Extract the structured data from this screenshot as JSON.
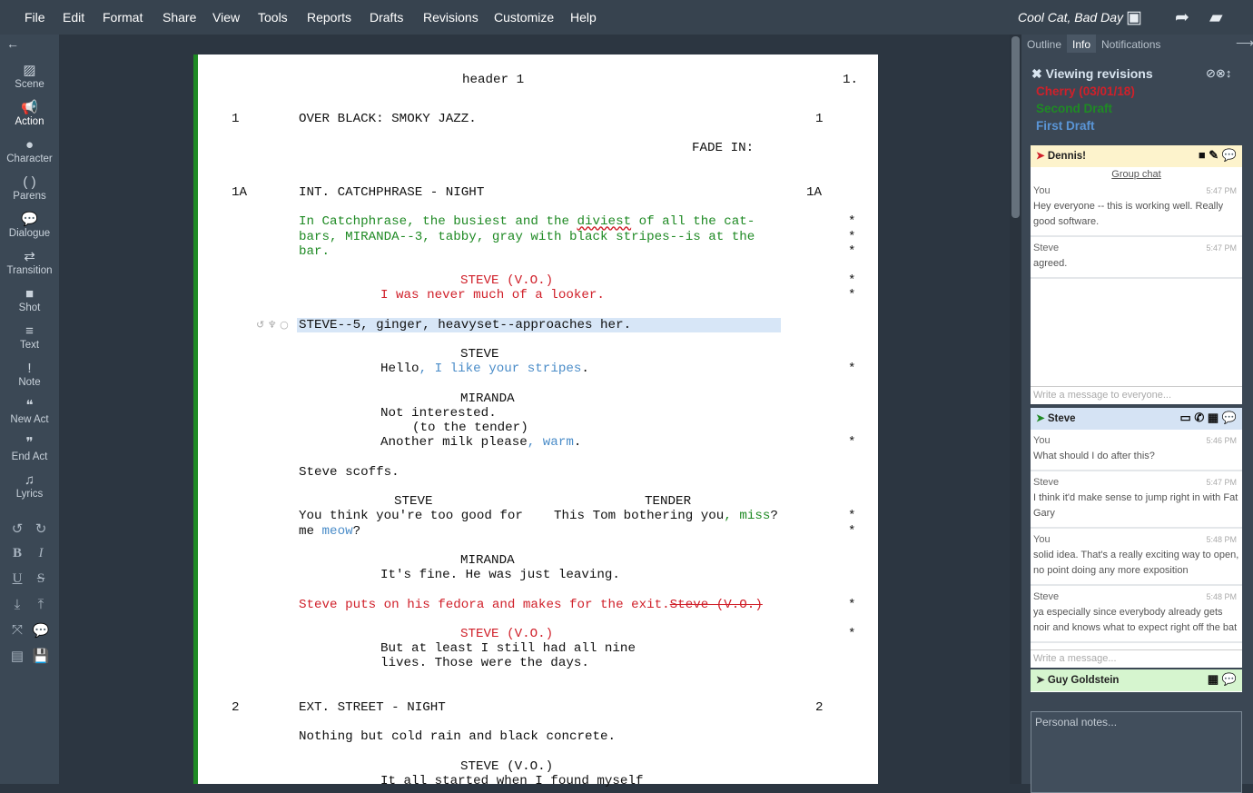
{
  "menu": [
    "File",
    "Edit",
    "Format",
    "Share",
    "View",
    "Tools",
    "Reports",
    "Drafts",
    "Revisions",
    "Customize",
    "Help"
  ],
  "document_title": "Cool Cat, Bad Day",
  "toolbar_icons": [
    "save-icon",
    "share-forward-icon",
    "open-folder-icon"
  ],
  "elements": [
    {
      "label": "Scene",
      "icon": "image-icon",
      "glyph": "▨"
    },
    {
      "label": "Action",
      "icon": "megaphone-icon",
      "glyph": "📢",
      "active": true
    },
    {
      "label": "Character",
      "icon": "person-icon",
      "glyph": "●"
    },
    {
      "label": "Parens",
      "icon": "parens-icon",
      "glyph": "( )"
    },
    {
      "label": "Dialogue",
      "icon": "speech-bubble-icon",
      "glyph": "💬"
    },
    {
      "label": "Transition",
      "icon": "exchange-icon",
      "glyph": "⇄"
    },
    {
      "label": "Shot",
      "icon": "video-camera-icon",
      "glyph": "■"
    },
    {
      "label": "Text",
      "icon": "lines-icon",
      "glyph": "≡"
    },
    {
      "label": "Note",
      "icon": "exclamation-icon",
      "glyph": "!"
    },
    {
      "label": "New Act",
      "icon": "open-quote-icon",
      "glyph": "❝"
    },
    {
      "label": "End Act",
      "icon": "close-quote-icon",
      "glyph": "❞"
    },
    {
      "label": "Lyrics",
      "icon": "music-note-icon",
      "glyph": "♫"
    }
  ],
  "format_tools": [
    {
      "icon": "undo-icon",
      "glyph": "↺"
    },
    {
      "icon": "redo-icon",
      "glyph": "↻"
    },
    {
      "icon": "bold-icon",
      "glyph": "B"
    },
    {
      "icon": "italic-icon",
      "glyph": "I"
    },
    {
      "icon": "underline-icon",
      "glyph": "U"
    },
    {
      "icon": "strikethrough-icon",
      "glyph": "S"
    },
    {
      "icon": "import-icon",
      "glyph": "⤓"
    },
    {
      "icon": "export-icon",
      "glyph": "⤒"
    },
    {
      "icon": "fullscreen-icon",
      "glyph": "⤧"
    },
    {
      "icon": "comments-icon",
      "glyph": "💬"
    },
    {
      "icon": "document-icon",
      "glyph": "▤"
    },
    {
      "icon": "save-icon",
      "glyph": "💾"
    }
  ],
  "script": {
    "header": "header 1",
    "page_number": "1.",
    "rows": [
      {
        "row": 0,
        "type": "scene",
        "num": "1",
        "segs": [
          {
            "t": "OVER BLACK: SMOKY JAZZ."
          }
        ]
      },
      {
        "row": 2,
        "type": "transition",
        "segs": [
          {
            "t": "FADE IN:"
          }
        ]
      },
      {
        "row": 5,
        "type": "scene",
        "num": "1A",
        "segs": [
          {
            "t": "INT. CATCHPHRASE - NIGHT"
          }
        ]
      },
      {
        "row": 7,
        "type": "action",
        "mark": true,
        "segs": [
          {
            "t": "In Catchphrase, the busiest and the ",
            "c": "green"
          },
          {
            "t": "diviest",
            "c": "green squig"
          },
          {
            "t": " of all the cat-",
            "c": "green"
          }
        ]
      },
      {
        "row": 8,
        "type": "action",
        "mark": true,
        "segs": [
          {
            "t": "bars, MIRANDA--3, tabby, gray with black stripes--is at the",
            "c": "green"
          }
        ]
      },
      {
        "row": 9,
        "type": "action",
        "mark": true,
        "segs": [
          {
            "t": "bar.",
            "c": "green"
          }
        ]
      },
      {
        "row": 11,
        "type": "character",
        "mark": true,
        "segs": [
          {
            "t": "STEVE (V.O.)",
            "c": "red"
          }
        ]
      },
      {
        "row": 12,
        "type": "dialogue",
        "mark": true,
        "segs": [
          {
            "t": "I was never much of a looker.",
            "c": "red"
          }
        ]
      },
      {
        "row": 14,
        "type": "action",
        "current": true,
        "segs": [
          {
            "t": "STEVE--5, ginger, heavyset--approaches her."
          }
        ]
      },
      {
        "row": 16,
        "type": "character",
        "segs": [
          {
            "t": "STEVE"
          }
        ]
      },
      {
        "row": 17,
        "type": "dialogue",
        "mark": true,
        "segs": [
          {
            "t": "Hello"
          },
          {
            "t": ", I like your stripes",
            "c": "blue"
          },
          {
            "t": "."
          }
        ]
      },
      {
        "row": 19,
        "type": "character",
        "segs": [
          {
            "t": "MIRANDA"
          }
        ]
      },
      {
        "row": 20,
        "type": "dialogue",
        "segs": [
          {
            "t": "Not interested."
          }
        ]
      },
      {
        "row": 21,
        "type": "parenthetical",
        "segs": [
          {
            "t": "(to the tender)"
          }
        ]
      },
      {
        "row": 22,
        "type": "dialogue",
        "mark": true,
        "segs": [
          {
            "t": "Another milk please"
          },
          {
            "t": ", warm",
            "c": "blue"
          },
          {
            "t": "."
          }
        ]
      },
      {
        "row": 24,
        "type": "action",
        "segs": [
          {
            "t": "Steve scoffs."
          }
        ]
      },
      {
        "row": 26,
        "type": "dual-character-left",
        "segs": [
          {
            "t": "STEVE"
          }
        ]
      },
      {
        "row": 26,
        "type": "dual-character-right",
        "segs": [
          {
            "t": "TENDER"
          }
        ]
      },
      {
        "row": 27,
        "type": "dual-dialogue-left",
        "mark": true,
        "segs": [
          {
            "t": "You think you're too good for"
          }
        ]
      },
      {
        "row": 27,
        "type": "dual-dialogue-right",
        "segs": [
          {
            "t": "This Tom bothering you"
          },
          {
            "t": ", miss",
            "c": "green"
          },
          {
            "t": "?"
          }
        ]
      },
      {
        "row": 28,
        "type": "dual-dialogue-left",
        "mark": true,
        "segs": [
          {
            "t": "me "
          },
          {
            "t": "meow",
            "c": "blue"
          },
          {
            "t": "?"
          }
        ]
      },
      {
        "row": 30,
        "type": "character",
        "segs": [
          {
            "t": "MIRANDA"
          }
        ]
      },
      {
        "row": 31,
        "type": "dialogue",
        "segs": [
          {
            "t": "It's fine. He was just leaving."
          }
        ]
      },
      {
        "row": 33,
        "type": "action",
        "mark": true,
        "segs": [
          {
            "t": "Steve puts on his fedora and makes for the exit.",
            "c": "red"
          },
          {
            "t": "Steve (V.O.)",
            "c": "red strike"
          }
        ]
      },
      {
        "row": 35,
        "type": "character",
        "mark": true,
        "segs": [
          {
            "t": "STEVE (V.O.)",
            "c": "red"
          }
        ]
      },
      {
        "row": 36,
        "type": "dialogue",
        "segs": [
          {
            "t": "But at least I still had all nine"
          }
        ]
      },
      {
        "row": 37,
        "type": "dialogue",
        "segs": [
          {
            "t": "lives. Those were the days."
          }
        ]
      },
      {
        "row": 40,
        "type": "scene",
        "num": "2",
        "segs": [
          {
            "t": "EXT. STREET - NIGHT"
          }
        ]
      },
      {
        "row": 42,
        "type": "action",
        "segs": [
          {
            "t": "Nothing but cold rain and black concrete."
          }
        ]
      },
      {
        "row": 44,
        "type": "character",
        "segs": [
          {
            "t": "STEVE (V.O.)"
          }
        ]
      },
      {
        "row": 45,
        "type": "dialogue",
        "segs": [
          {
            "t": "It all started when I found myself"
          }
        ]
      }
    ],
    "revision_mark": "*"
  },
  "panel": {
    "tabs": [
      "Outline",
      "Info",
      "Notifications"
    ],
    "active_tab": "Info",
    "viewing_revisions": "Viewing revisions",
    "revisions": [
      {
        "label": "Cherry (03/01/18)",
        "color": "#d0202a"
      },
      {
        "label": "Second Draft",
        "color": "#1f8a24"
      },
      {
        "label": "First Draft",
        "color": "#5a95d6"
      }
    ],
    "chats": [
      {
        "name": "Dennis!",
        "header_color": "#fdf3cc",
        "arrow_color": "#d0202a",
        "icons": "■ ✎ 💬",
        "link": "Group chat",
        "messages": [
          {
            "who": "You",
            "time": "5:47 PM",
            "text": "Hey everyone -- this is working well. Really good software."
          },
          {
            "who": "Steve",
            "time": "5:47 PM",
            "text": "agreed."
          }
        ],
        "placeholder": "Write a message to everyone..."
      },
      {
        "name": "Steve",
        "header_color": "#d5e3f4",
        "arrow_color": "#1f8a24",
        "icons": "▭ ✆ ▦ 💬",
        "messages": [
          {
            "who": "You",
            "time": "5:46 PM",
            "text": "What should I do after this?"
          },
          {
            "who": "Steve",
            "time": "5:47 PM",
            "text": "I think it'd make sense to jump right in with Fat Gary"
          },
          {
            "who": "You",
            "time": "5:48 PM",
            "text": "solid idea. That's a really exciting way to open, no point doing any more exposition"
          },
          {
            "who": "Steve",
            "time": "5:48 PM",
            "text": "ya especially since everybody already gets noir and knows what to expect right off the bat"
          }
        ],
        "placeholder": "Write a message..."
      },
      {
        "name": "Guy Goldstein",
        "header_color": "#d6f5cf",
        "arrow_color": "#333",
        "icons": "▦ 💬"
      }
    ],
    "notes_placeholder": "Personal notes..."
  }
}
